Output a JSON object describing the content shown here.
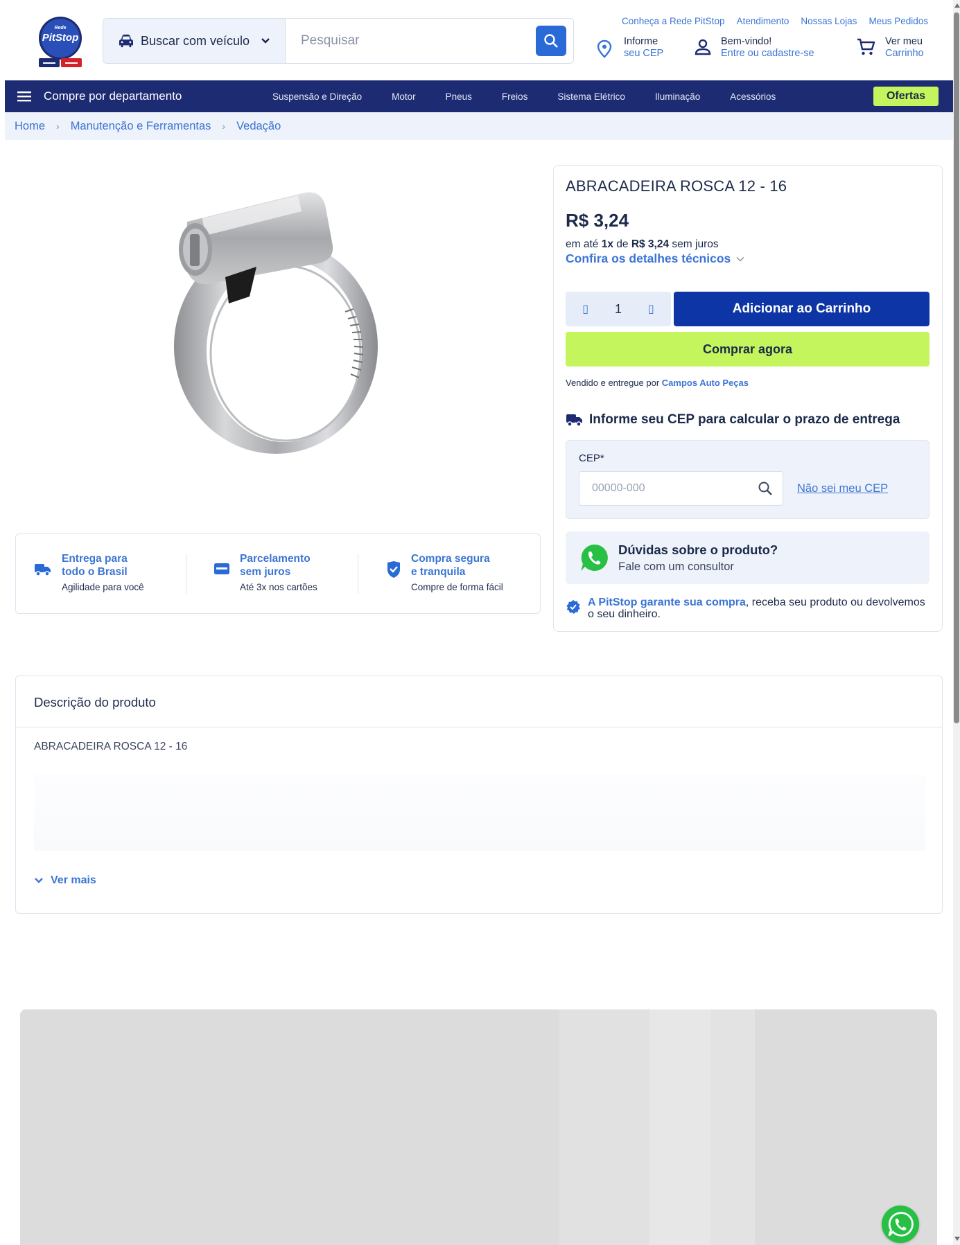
{
  "header": {
    "logo_text_top": "Rede",
    "logo_text_main": "PitStop",
    "vehicle_search_label": "Buscar com veículo",
    "search_placeholder": "Pesquisar",
    "top_links": [
      "Conheça a Rede PitStop",
      "Atendimento",
      "Nossas Lojas",
      "Meus Pedidos"
    ],
    "location": {
      "line1": "Informe",
      "line2": "seu CEP"
    },
    "account": {
      "line1": "Bem-vindo!",
      "line2": "Entre ou cadastre-se"
    },
    "cart": {
      "line1": "Ver meu",
      "line2": "Carrinho"
    }
  },
  "nav": {
    "department_label": "Compre por departamento",
    "links": [
      "Suspensão e Direção",
      "Motor",
      "Pneus",
      "Freios",
      "Sistema Elétrico",
      "Iluminação",
      "Acessórios"
    ],
    "offers_label": "Ofertas"
  },
  "breadcrumb": [
    "Home",
    "Manutenção e Ferramentas",
    "Vedação"
  ],
  "benefits": [
    {
      "title_l1": "Entrega para",
      "title_l2": "todo o Brasil",
      "subtitle": "Agilidade para você",
      "icon": "truck-icon"
    },
    {
      "title_l1": "Parcelamento",
      "title_l2": "sem juros",
      "subtitle": "Até 3x nos cartões",
      "icon": "credit-card-icon"
    },
    {
      "title_l1": "Compra segura",
      "title_l2": "e tranquila",
      "subtitle": "Compre de forma fácil",
      "icon": "shield-check-icon"
    }
  ],
  "product": {
    "title": "ABRACADEIRA ROSCA 12 - 16",
    "price": "R$ 3,24",
    "installment_prefix": "em até ",
    "installment_count": "1x",
    "installment_mid": " de ",
    "installment_value": "R$ 3,24",
    "installment_suffix": " sem juros",
    "details_link": "Confira os detalhes técnicos",
    "quantity": "1",
    "add_to_cart": "Adicionar ao Carrinho",
    "buy_now": "Comprar agora",
    "sold_by_prefix": "Vendido e entregue por ",
    "seller": "Campos Auto Peças"
  },
  "shipping": {
    "title": "Informe seu CEP para calcular o prazo de entrega",
    "cep_label": "CEP*",
    "cep_placeholder": "00000-000",
    "unknown_cep": "Não sei meu CEP"
  },
  "help": {
    "title": "Dúvidas sobre o produto?",
    "subtitle": "Fale com um consultor"
  },
  "guarantee": {
    "link_text": "A PitStop garante sua compra",
    "text": ", receba seu produto ou devolvemos o seu dinheiro."
  },
  "description": {
    "heading": "Descrição do produto",
    "text": "ABRACADEIRA ROSCA 12 - 16",
    "more_label": "Ver mais"
  },
  "colors": {
    "navy": "#1d2b72",
    "blue_link": "#3b74d4",
    "cart_button": "#0e35a6",
    "lime": "#c4f55d",
    "whatsapp": "#27c045"
  }
}
